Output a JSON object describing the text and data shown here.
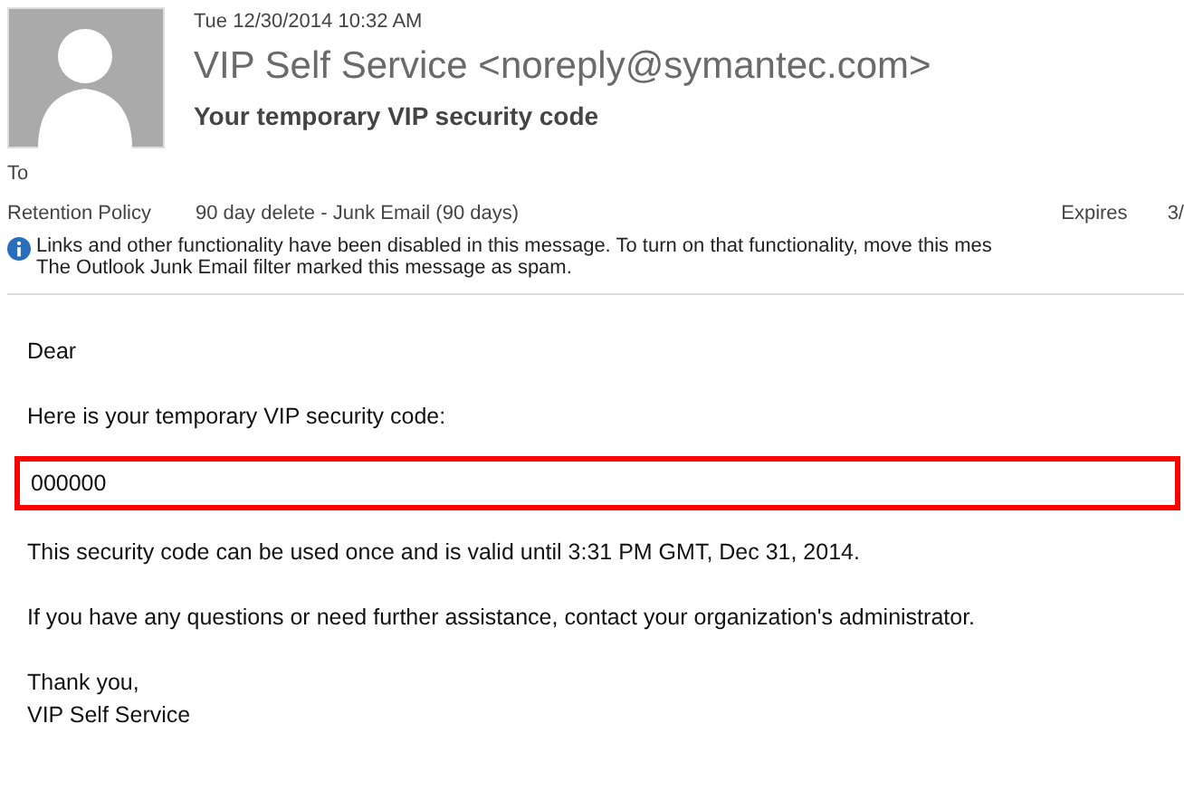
{
  "header": {
    "date": "Tue 12/30/2014 10:32 AM",
    "sender": "VIP Self Service <noreply@symantec.com>",
    "subject": "Your temporary VIP security code",
    "to_label": "To",
    "retention_label": "Retention Policy",
    "retention_value": "90 day delete - Junk Email (90 days)",
    "expires_label": "Expires",
    "expires_value": "3/",
    "info_lines": [
      "Links and other functionality have been disabled in this message. To turn on that functionality, move this mes",
      "The Outlook Junk Email filter marked this message as spam."
    ]
  },
  "body": {
    "greeting": "Dear",
    "intro": "Here is your temporary VIP security code:",
    "code": "000000",
    "validity": "This security code can be used once and is valid until 3:31 PM GMT, Dec 31, 2014.",
    "questions": "If you have any questions or need further assistance, contact your organization's administrator.",
    "closing": "Thank you,",
    "signature": "VIP Self Service"
  }
}
